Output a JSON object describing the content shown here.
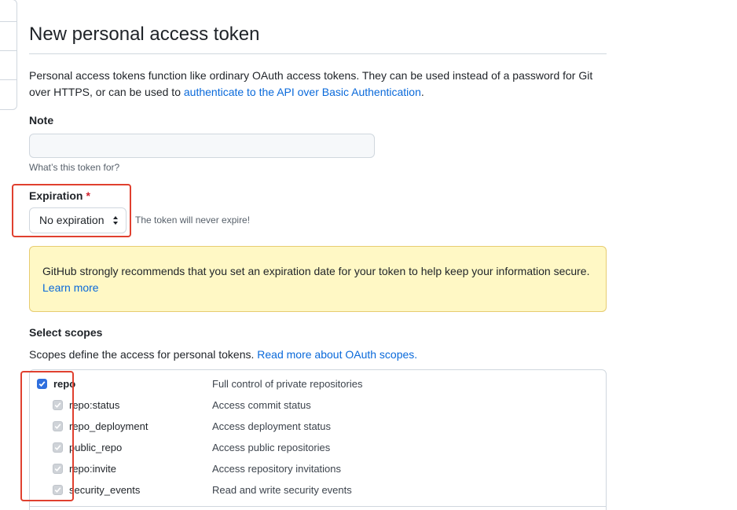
{
  "page": {
    "title": "New personal access token",
    "intro_text": "Personal access tokens function like ordinary OAuth access tokens. They can be used instead of a password for Git over HTTPS, or can be used to ",
    "intro_link": "authenticate to the API over Basic Authentication",
    "intro_end": "."
  },
  "note": {
    "label": "Note",
    "value": "",
    "placeholder": "",
    "hint": "What’s this token for?"
  },
  "expiration": {
    "label": "Expiration",
    "required_mark": "*",
    "selected": "No expiration",
    "hint": "The token will never expire!"
  },
  "flash": {
    "text": "GitHub strongly recommends that you set an expiration date for your token to help keep your information secure. ",
    "link": "Learn more"
  },
  "scopes": {
    "label": "Select scopes",
    "desc": "Scopes define the access for personal tokens. ",
    "desc_link": "Read more about OAuth scopes.",
    "items": [
      {
        "name": "repo",
        "desc": "Full control of private repositories",
        "checked": true,
        "parent": true
      },
      {
        "name": "repo:status",
        "desc": "Access commit status",
        "checked": true,
        "parent": false
      },
      {
        "name": "repo_deployment",
        "desc": "Access deployment status",
        "checked": true,
        "parent": false
      },
      {
        "name": "public_repo",
        "desc": "Access public repositories",
        "checked": true,
        "parent": false
      },
      {
        "name": "repo:invite",
        "desc": "Access repository invitations",
        "checked": true,
        "parent": false
      },
      {
        "name": "security_events",
        "desc": "Read and write security events",
        "checked": true,
        "parent": false
      }
    ]
  },
  "colors": {
    "link": "#0969da",
    "highlight": "#e0402f",
    "checkbox": "#2f6fde",
    "flash_bg": "#fff8c5",
    "required": "#cf222e"
  }
}
